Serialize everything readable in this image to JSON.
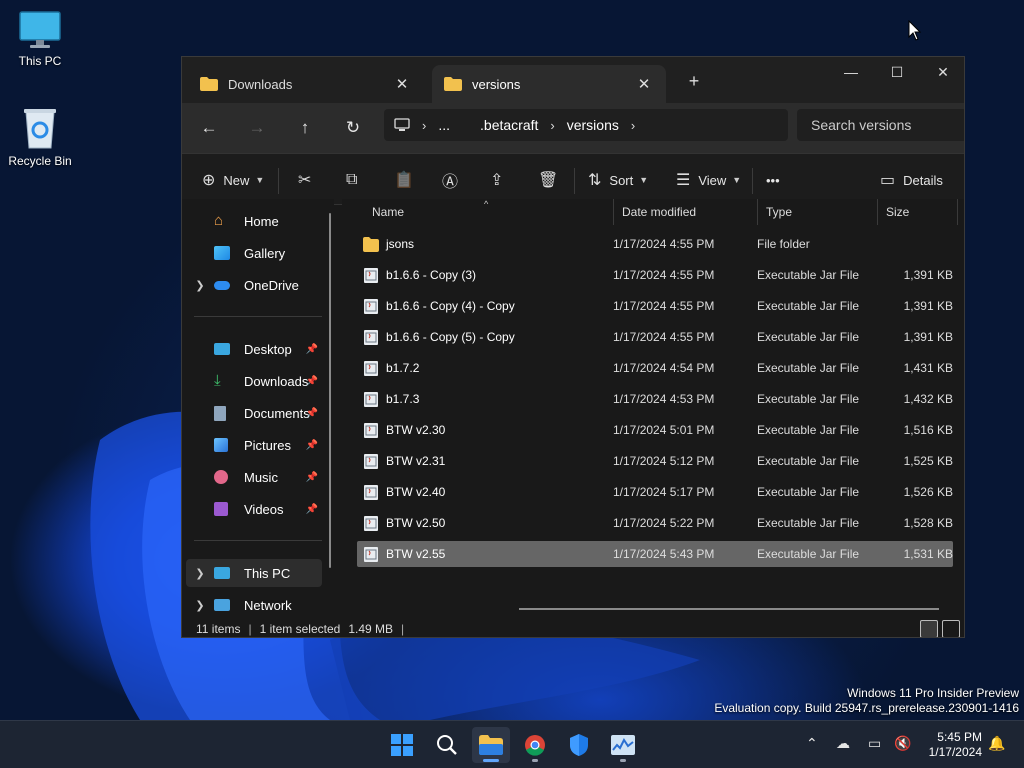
{
  "desktop": {
    "icons": [
      {
        "label": "This PC",
        "icon": "monitor-icon"
      },
      {
        "label": "Recycle Bin",
        "icon": "recycle-bin-icon"
      }
    ],
    "watermark_line1": "Windows 11 Pro Insider Preview",
    "watermark_line2": "Evaluation copy. Build 25947.rs_prerelease.230901-1416"
  },
  "window": {
    "tabs": [
      {
        "label": "Downloads",
        "active": false
      },
      {
        "label": "versions",
        "active": true
      }
    ],
    "controls": {
      "minimize": "—",
      "maximize": "☐",
      "close": "✕"
    },
    "breadcrumb": [
      "...",
      ".betacraft",
      "versions"
    ],
    "search_placeholder": "Search versions",
    "commands": {
      "new": "New",
      "sort": "Sort",
      "view": "View",
      "more": "•••",
      "details": "Details"
    },
    "sidebar": {
      "top": [
        {
          "label": "Home",
          "icon": "home-icon"
        },
        {
          "label": "Gallery",
          "icon": "gallery-icon"
        },
        {
          "label": "OneDrive",
          "icon": "cloud-icon"
        }
      ],
      "quick": [
        {
          "label": "Desktop",
          "icon": "desktop-icon"
        },
        {
          "label": "Downloads",
          "icon": "download-icon"
        },
        {
          "label": "Documents",
          "icon": "documents-icon"
        },
        {
          "label": "Pictures",
          "icon": "pictures-icon"
        },
        {
          "label": "Music",
          "icon": "music-icon"
        },
        {
          "label": "Videos",
          "icon": "videos-icon"
        }
      ],
      "bottom": [
        {
          "label": "This PC",
          "icon": "monitor-icon"
        },
        {
          "label": "Network",
          "icon": "network-icon"
        }
      ]
    },
    "columns": {
      "name": "Name",
      "date": "Date modified",
      "type": "Type",
      "size": "Size"
    },
    "files": [
      {
        "name": "jsons",
        "date": "1/17/2024 4:55 PM",
        "type": "File folder",
        "size": "",
        "kind": "folder"
      },
      {
        "name": "b1.6.6 - Copy (3)",
        "date": "1/17/2024 4:55 PM",
        "type": "Executable Jar File",
        "size": "1,391 KB",
        "kind": "jar"
      },
      {
        "name": "b1.6.6 - Copy (4) - Copy",
        "date": "1/17/2024 4:55 PM",
        "type": "Executable Jar File",
        "size": "1,391 KB",
        "kind": "jar"
      },
      {
        "name": "b1.6.6 - Copy (5) - Copy",
        "date": "1/17/2024 4:55 PM",
        "type": "Executable Jar File",
        "size": "1,391 KB",
        "kind": "jar"
      },
      {
        "name": "b1.7.2",
        "date": "1/17/2024 4:54 PM",
        "type": "Executable Jar File",
        "size": "1,431 KB",
        "kind": "jar"
      },
      {
        "name": "b1.7.3",
        "date": "1/17/2024 4:53 PM",
        "type": "Executable Jar File",
        "size": "1,432 KB",
        "kind": "jar"
      },
      {
        "name": "BTW v2.30",
        "date": "1/17/2024 5:01 PM",
        "type": "Executable Jar File",
        "size": "1,516 KB",
        "kind": "jar"
      },
      {
        "name": "BTW v2.31",
        "date": "1/17/2024 5:12 PM",
        "type": "Executable Jar File",
        "size": "1,525 KB",
        "kind": "jar"
      },
      {
        "name": "BTW v2.40",
        "date": "1/17/2024 5:17 PM",
        "type": "Executable Jar File",
        "size": "1,526 KB",
        "kind": "jar"
      },
      {
        "name": "BTW v2.50",
        "date": "1/17/2024 5:22 PM",
        "type": "Executable Jar File",
        "size": "1,528 KB",
        "kind": "jar"
      },
      {
        "name": "BTW v2.55",
        "date": "1/17/2024 5:43 PM",
        "type": "Executable Jar File",
        "size": "1,531 KB",
        "kind": "jar",
        "selected": true
      }
    ],
    "status": {
      "items": "11 items",
      "selected": "1 item selected",
      "size": "1.49 MB"
    }
  },
  "taskbar": {
    "clock_time": "5:45 PM",
    "clock_date": "1/17/2024"
  },
  "colors": {
    "accent": "#60a5fa",
    "folder": "#f2c14e",
    "selection": "#666666"
  }
}
